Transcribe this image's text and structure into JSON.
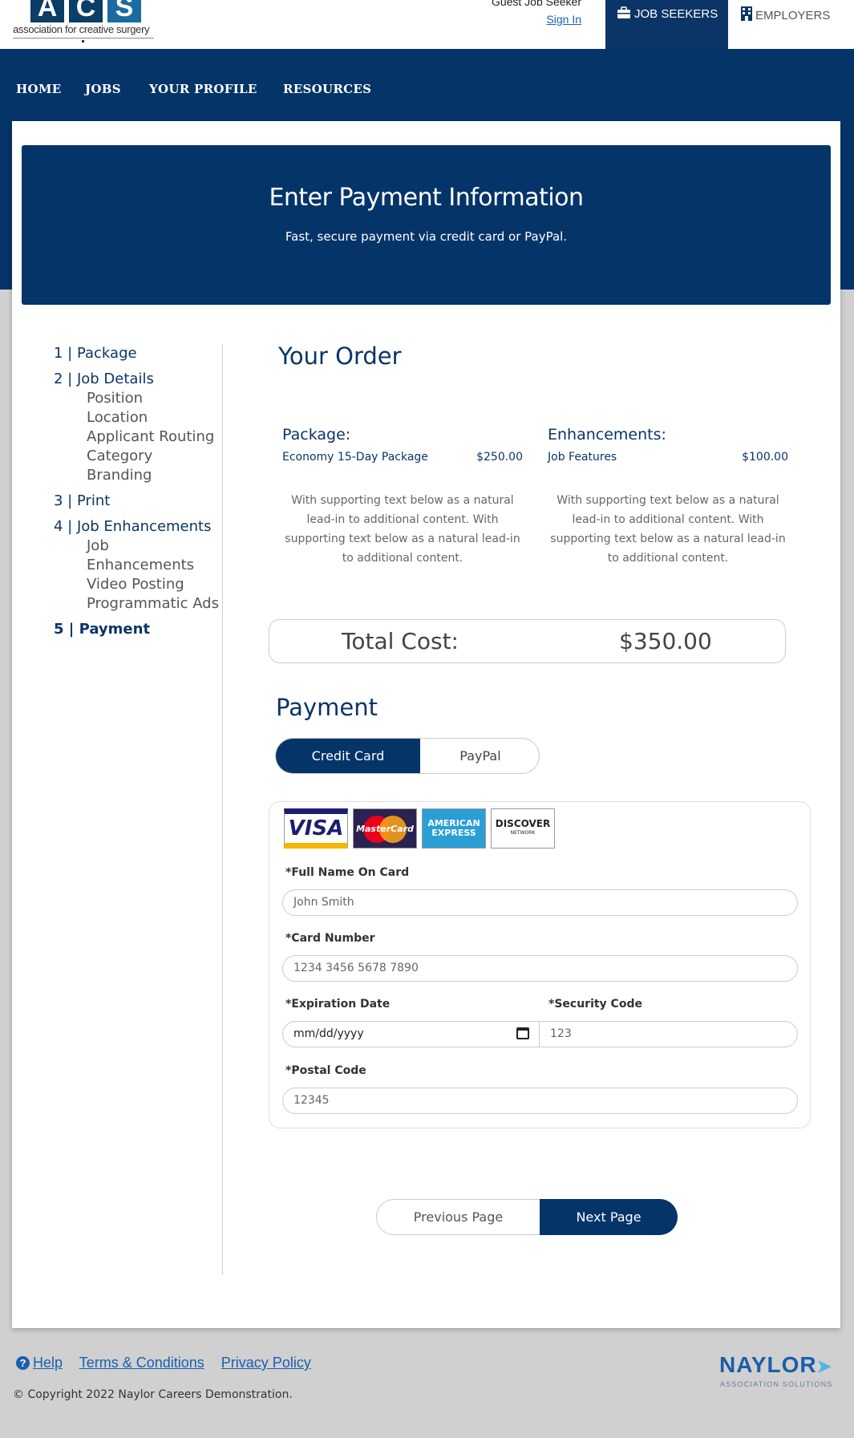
{
  "header": {
    "logo_letters": [
      "A",
      "C",
      "S"
    ],
    "logo_tagline": "association for creative surgery",
    "guest_label": "Guest Job Seeker",
    "sign_in": "Sign In",
    "tab_job_seekers": "JOB SEEKERS",
    "tab_employers": "EMPLOYERS"
  },
  "nav": {
    "items": [
      "HOME",
      "JOBS",
      "YOUR PROFILE",
      "RESOURCES"
    ]
  },
  "hero": {
    "title": "Enter Payment Information",
    "subtitle": "Fast, secure payment via credit card or PayPal."
  },
  "steps": {
    "s1": "1 | Package",
    "s2": "2 | Job Details",
    "s2_subs": [
      "Position",
      "Location",
      "Applicant Routing",
      "Category",
      "Branding"
    ],
    "s3": "3 | Print",
    "s4": "4 | Job Enhancements",
    "s4_subs": [
      "Job",
      "Enhancements",
      "Video Posting",
      "Programmatic Ads"
    ],
    "s5": "5 | Payment"
  },
  "order": {
    "title": "Your Order",
    "package_head": "Package:",
    "package_name": "Economy 15-Day Package",
    "package_price": "$250.00",
    "package_desc": "With supporting text below as a natural lead-in to additional content. With supporting text below as a natural lead-in to additional content.",
    "enh_head": "Enhancements:",
    "enh_name": "Job Features",
    "enh_price": "$100.00",
    "enh_desc": "With supporting text below as a natural lead-in to additional content. With supporting text below as a natural lead-in to additional content.",
    "total_label": "Total Cost:",
    "total_value": "$350.00"
  },
  "payment": {
    "title": "Payment",
    "tab_credit": "Credit Card",
    "tab_paypal": "PayPal",
    "card_logos": {
      "visa": "VISA",
      "mastercard": "MasterCard",
      "amex_1": "AMERICAN",
      "amex_2": "EXPRESS",
      "discover": "DISCOVER",
      "discover_sub": "NETWORK"
    },
    "name_label": "*Full Name On Card",
    "name_placeholder": "John Smith",
    "number_label": "*Card Number",
    "number_placeholder": "1234 3456 5678 7890",
    "exp_label": "*Expiration Date",
    "exp_placeholder": "mm/dd/yyyy",
    "sec_label": "*Security Code",
    "sec_placeholder": "123",
    "postal_label": "*Postal Code",
    "postal_placeholder": "12345"
  },
  "buttons": {
    "previous": "Previous Page",
    "next": "Next Page"
  },
  "footer": {
    "help": "Help",
    "terms": "Terms & Conditions",
    "privacy": "Privacy Policy",
    "copyright": "© Copyright 2022 Naylor Careers Demonstration.",
    "brand": "NAYLOR",
    "brand_sub": "ASSOCIATION SOLUTIONS"
  }
}
